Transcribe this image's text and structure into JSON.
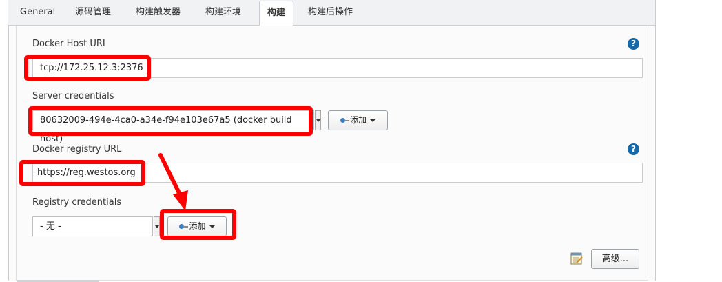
{
  "tabs": [
    {
      "label": "General",
      "active": false
    },
    {
      "label": "源码管理",
      "active": false
    },
    {
      "label": "构建触发器",
      "active": false
    },
    {
      "label": "构建环境",
      "active": false
    },
    {
      "label": "构建",
      "active": true
    },
    {
      "label": "构建后操作",
      "active": false
    }
  ],
  "docker_host": {
    "label": "Docker Host URI",
    "value": "tcp://172.25.12.3:2376",
    "help_icon": "question-circle-icon",
    "help_glyph": "?"
  },
  "server_credentials": {
    "label": "Server credentials",
    "selected": "80632009-494e-4ca0-a34e-f94e103e67a5 (docker build host)",
    "add_label": "添加"
  },
  "docker_registry": {
    "label": "Docker registry URL",
    "value": "https://reg.westos.org",
    "help_icon": "question-circle-icon",
    "help_glyph": "?"
  },
  "registry_credentials": {
    "label": "Registry credentials",
    "selected": "- 无 -",
    "add_label": "添加"
  },
  "advanced": {
    "label": "高级...",
    "icon": "notepad-icon"
  },
  "annotations": {
    "highlight_color": "#ff0000",
    "arrow_icon": "red-arrow-icon"
  },
  "colors": {
    "help_icon": "#1668a8",
    "tab_bar": "#f1f2f4",
    "highlight": "#ff0000"
  }
}
